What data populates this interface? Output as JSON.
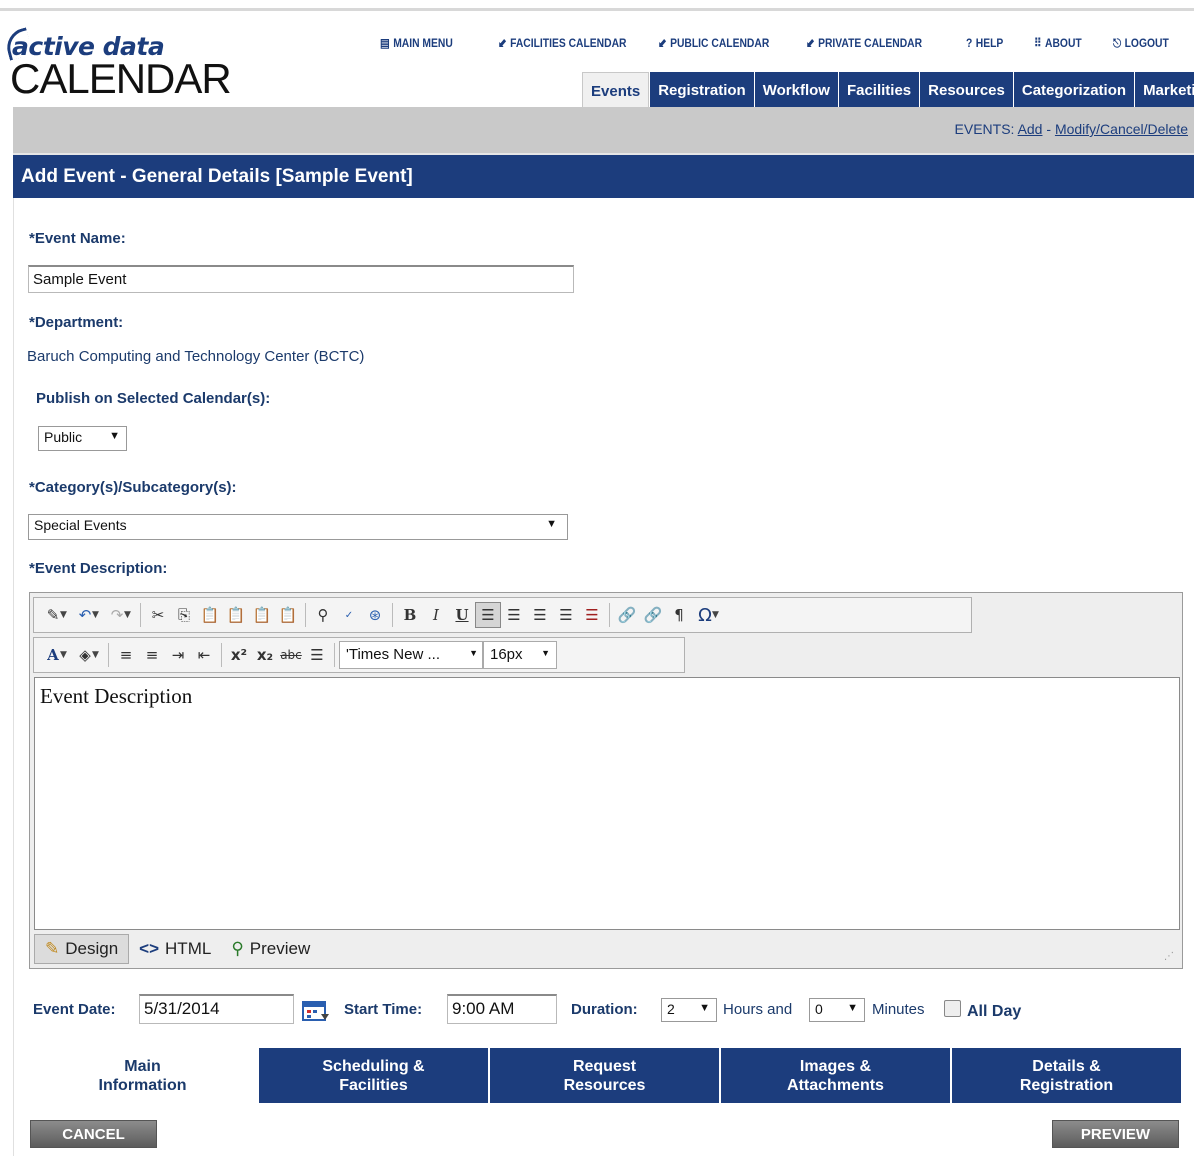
{
  "logo": {
    "line1": "active data",
    "line2": "CALENDAR"
  },
  "topnav": [
    {
      "icon": "▤",
      "label": "MAIN MENU"
    },
    {
      "icon": "⬋",
      "label": "FACILITIES CALENDAR"
    },
    {
      "icon": "⬋",
      "label": "PUBLIC CALENDAR"
    },
    {
      "icon": "⬋",
      "label": "PRIVATE CALENDAR"
    },
    {
      "icon": "?",
      "label": "HELP"
    },
    {
      "icon": "⠿",
      "label": "ABOUT"
    },
    {
      "icon": "⎋",
      "label": "LOGOUT"
    }
  ],
  "tabs": [
    "Events",
    "Registration",
    "Workflow",
    "Facilities",
    "Resources",
    "Categorization",
    "Marketing"
  ],
  "breadcrumb": {
    "prefix": "EVENTS: ",
    "add": "Add",
    "sep": " - ",
    "modify": "Modify/Cancel/Delete"
  },
  "page_title": "Add Event - General Details [Sample Event]",
  "form": {
    "event_name_label": "*Event Name:",
    "event_name_value": "Sample Event",
    "department_label": "*Department:",
    "department_value": "Baruch Computing and Technology Center (BCTC)",
    "publish_label": "Publish on Selected Calendar(s):",
    "publish_value": "Public",
    "category_label": "*Category(s)/Subcategory(s):",
    "category_value": "Special Events",
    "description_label": "*Event Description:",
    "description_value": "Event Description",
    "font_name": "'Times New ...",
    "font_size": "16px",
    "modes": {
      "design": "Design",
      "html": "HTML",
      "preview": "Preview"
    },
    "event_date_label": "Event Date:",
    "event_date_value": "5/31/2014",
    "start_time_label": "Start Time:",
    "start_time_value": "9:00 AM",
    "duration_label": "Duration:",
    "duration_hours": "2",
    "hours_and": "Hours and",
    "duration_minutes": "0",
    "minutes": "Minutes",
    "all_day": "All Day"
  },
  "bottom_tabs": [
    {
      "line1": "Main",
      "line2": "Information"
    },
    {
      "line1": "Scheduling &",
      "line2": "Facilities"
    },
    {
      "line1": "Request",
      "line2": "Resources"
    },
    {
      "line1": "Images &",
      "line2": "Attachments"
    },
    {
      "line1": "Details &",
      "line2": "Registration"
    }
  ],
  "buttons": {
    "cancel": "CANCEL",
    "preview": "PREVIEW"
  }
}
